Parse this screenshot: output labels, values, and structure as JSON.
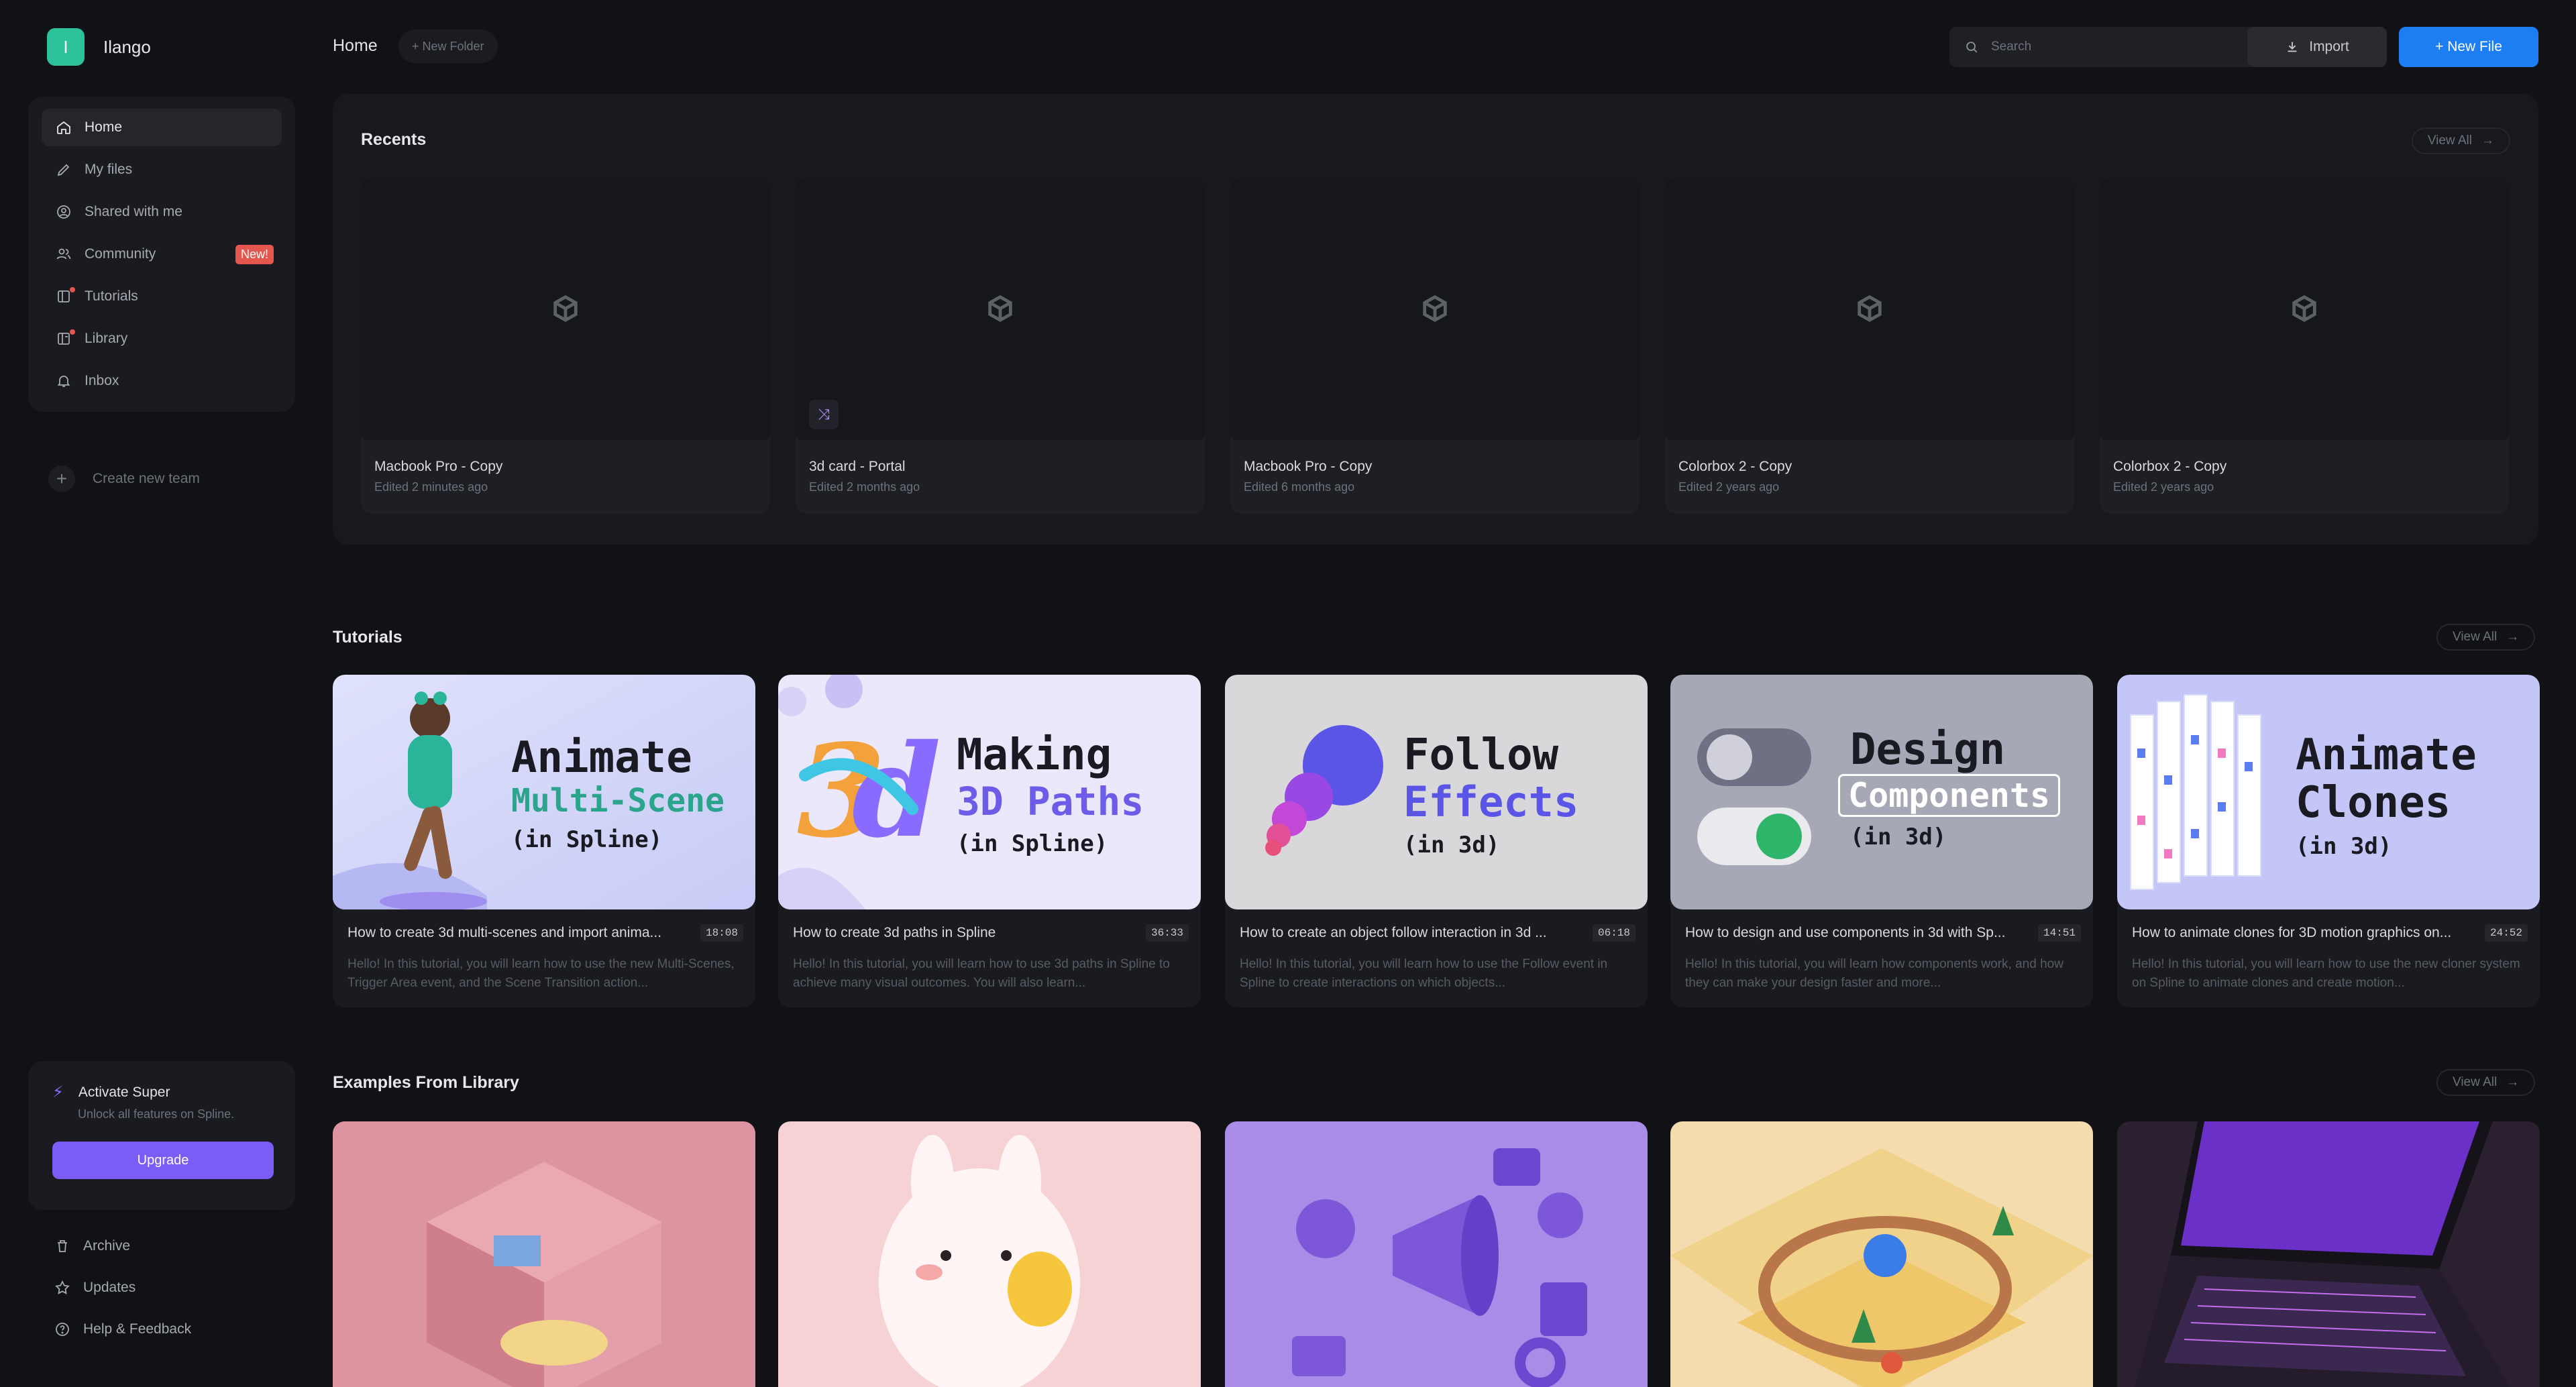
{
  "brand": {
    "initial": "I",
    "name": "Ilango"
  },
  "nav": {
    "items": [
      {
        "label": "Home",
        "icon": "home-icon"
      },
      {
        "label": "My files",
        "icon": "pencil-icon"
      },
      {
        "label": "Shared with me",
        "icon": "user-circle-icon"
      },
      {
        "label": "Community",
        "icon": "users-icon",
        "badge": "New!"
      },
      {
        "label": "Tutorials",
        "icon": "book-icon"
      },
      {
        "label": "Library",
        "icon": "library-icon"
      },
      {
        "label": "Inbox",
        "icon": "bell-icon"
      }
    ],
    "create_team": "Create new team"
  },
  "super": {
    "title": "Activate Super",
    "subtitle": "Unlock all features on Spline.",
    "button": "Upgrade"
  },
  "bottom_links": [
    {
      "label": "Archive",
      "icon": "trash-icon"
    },
    {
      "label": "Updates",
      "icon": "star-icon"
    },
    {
      "label": "Help & Feedback",
      "icon": "help-icon"
    }
  ],
  "topbar": {
    "title": "Home",
    "new_folder": "+ New Folder",
    "search_placeholder": "Search",
    "import": "Import",
    "new_file": "+ New File"
  },
  "recents": {
    "title": "Recents",
    "view_all": "View All",
    "items": [
      {
        "name": "Macbook Pro - Copy",
        "time": "Edited 2 minutes ago"
      },
      {
        "name": "3d card - Portal",
        "time": "Edited 2 months ago"
      },
      {
        "name": "Macbook Pro - Copy",
        "time": "Edited 6 months ago"
      },
      {
        "name": "Colorbox 2 - Copy",
        "time": "Edited 2 years ago"
      },
      {
        "name": "Colorbox 2 - Copy",
        "time": "Edited 2 years ago"
      }
    ]
  },
  "tutorials": {
    "title": "Tutorials",
    "view_all": "View All",
    "items": [
      {
        "line1": "Animate",
        "line2": "Multi-Scene",
        "line3": "(in Spline)",
        "title": "How to create 3d multi-scenes and import anima...",
        "duration": "18:08",
        "desc": "Hello! In this tutorial, you will learn how to use the new Multi-Scenes, Trigger Area event, and the Scene Transition action..."
      },
      {
        "line1": "Making",
        "line2": "3D Paths",
        "line3": "(in Spline)",
        "title": "How to create 3d paths in Spline",
        "duration": "36:33",
        "desc": "Hello! In this tutorial, you will learn how to use 3d paths in Spline to achieve many visual outcomes. You will also learn..."
      },
      {
        "line1": "Follow",
        "line2": "Effects",
        "line3": "(in 3d)",
        "title": "How to create an object follow interaction in 3d ...",
        "duration": "06:18",
        "desc": "Hello! In this tutorial, you will learn how to use the Follow event in Spline to create interactions on which objects..."
      },
      {
        "line1": "Design",
        "line2": "Components",
        "line3": "(in 3d)",
        "title": "How to design and use components in 3d with Sp...",
        "duration": "14:51",
        "desc": "Hello! In this tutorial, you will learn how components work, and how they can make your design faster and more..."
      },
      {
        "line1": "Animate",
        "line2": "Clones",
        "line3": "(in 3d)",
        "title": "How to animate clones for 3D motion graphics on...",
        "duration": "24:52",
        "desc": "Hello! In this tutorial, you will learn how to use the new cloner system on Spline to animate clones and create motion..."
      }
    ]
  },
  "examples": {
    "title": "Examples From Library",
    "view_all": "View All"
  },
  "colors": {
    "accent_blue": "#1d7df2",
    "accent_purple": "#7b5cf5",
    "brand_green": "#2ec29a",
    "badge_red": "#e4574f"
  }
}
